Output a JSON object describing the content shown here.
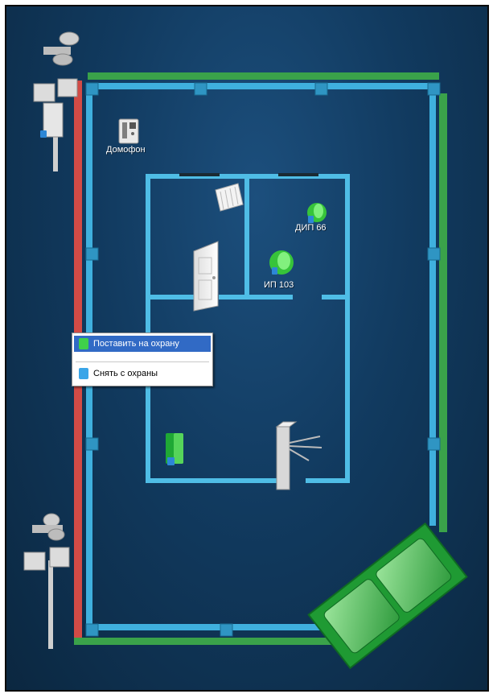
{
  "plan": {
    "labels": {
      "intercom": "Домофон",
      "dip": "ДИП 66",
      "ip": "ИП 103"
    },
    "colors": {
      "inner_wall": "#4fbde6",
      "fence_green": "#3aa24a",
      "fence_red": "#d24b46"
    }
  },
  "context_menu": {
    "items": [
      {
        "label": "Поставить на охрану",
        "icon": "arm-icon",
        "icon_color": "#3fd04a",
        "selected": true
      },
      {
        "label": "Снять с охраны",
        "icon": "disarm-icon",
        "icon_color": "#3aa5e8",
        "selected": false
      }
    ]
  }
}
